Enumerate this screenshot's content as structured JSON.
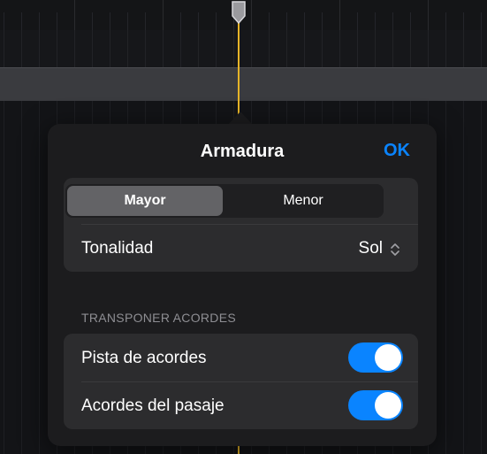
{
  "popover": {
    "title": "Armadura",
    "ok_label": "OK",
    "mode_segment": {
      "options": [
        "Mayor",
        "Menor"
      ],
      "selected": "Mayor"
    },
    "key_row": {
      "label": "Tonalidad",
      "value": "Sol"
    },
    "transpose_section": {
      "header": "TRANSPONER ACORDES",
      "rows": [
        {
          "label": "Pista de acordes",
          "on": true
        },
        {
          "label": "Acordes del pasaje",
          "on": true
        }
      ]
    }
  },
  "colors": {
    "accent": "#0a84ff",
    "playhead": "#e6b428",
    "popover_bg": "#1c1c1e",
    "group_bg": "#2c2c2e"
  }
}
